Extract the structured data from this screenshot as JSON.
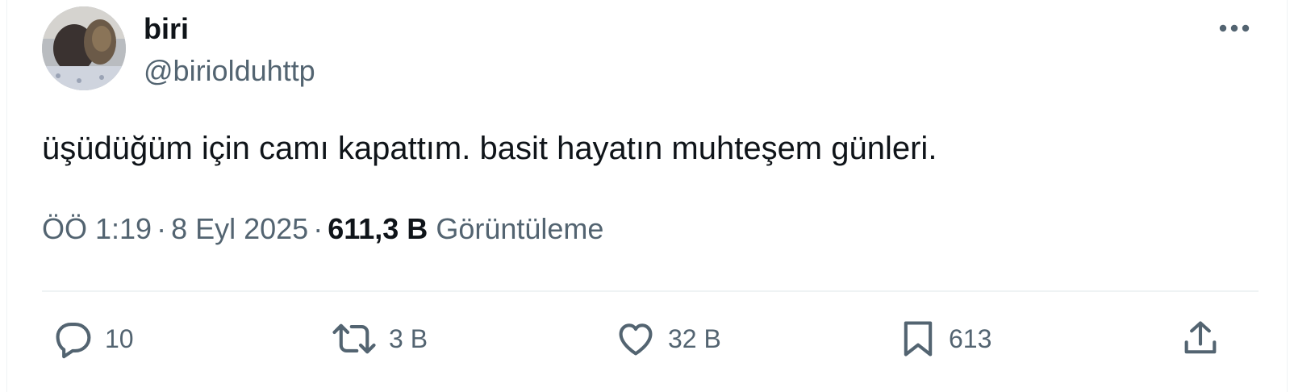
{
  "user": {
    "display_name": "biri",
    "handle": "@birioldu​http"
  },
  "tweet": {
    "text": "üşüdüğüm için camı kapattım. basit hayatın muhteşem günleri."
  },
  "meta": {
    "time": "ÖÖ 1:19",
    "separator": "·",
    "date": "8 Eyl 2025",
    "views_count": "611,3 B",
    "views_label": "Görüntüleme"
  },
  "actions": {
    "reply_count": "10",
    "retweet_count": "3 B",
    "like_count": "32 B",
    "bookmark_count": "613"
  },
  "colors": {
    "text_primary": "#0f1419",
    "text_secondary": "#536471",
    "divider": "#eff3f4"
  },
  "icons": {
    "more": "more-horizontal-icon",
    "reply": "reply-icon",
    "retweet": "retweet-icon",
    "like": "heart-icon",
    "bookmark": "bookmark-icon",
    "share": "share-icon"
  }
}
